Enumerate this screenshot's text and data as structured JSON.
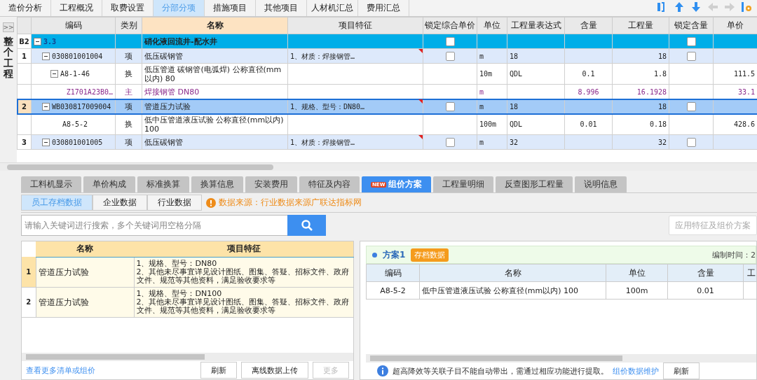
{
  "top_tabs": [
    {
      "label": "造价分析",
      "selected": false
    },
    {
      "label": "工程概况",
      "selected": false
    },
    {
      "label": "取费设置",
      "selected": false
    },
    {
      "label": "分部分项",
      "selected": true
    },
    {
      "label": "措施项目",
      "selected": false
    },
    {
      "label": "其他项目",
      "selected": false
    },
    {
      "label": "人材机汇总",
      "selected": false
    },
    {
      "label": "费用汇总",
      "selected": false
    }
  ],
  "toolbar": [
    {
      "kind": "swap",
      "disabled": false
    },
    {
      "kind": "up",
      "disabled": false
    },
    {
      "kind": "down",
      "disabled": false
    },
    {
      "kind": "left",
      "disabled": true
    },
    {
      "kind": "right",
      "disabled": true
    },
    {
      "kind": "settings",
      "disabled": false
    }
  ],
  "sidebar": {
    "toggle": ">>",
    "title": "整个工程"
  },
  "grid": {
    "columns": [
      "编码",
      "类别",
      "名称",
      "项目特征",
      "锁定综合单价",
      "单位",
      "工程量表达式",
      "含量",
      "工程量",
      "锁定含量",
      "单价"
    ],
    "rows": [
      {
        "kind": "section",
        "num": "B2",
        "code": "3.3",
        "type": "",
        "name": "硝化液回流井-配水井",
        "selected": false,
        "expanded": true,
        "lock_price": false,
        "lock_content": false,
        "children": [
          {
            "kind": "item",
            "num": "1",
            "code": "030801001004",
            "type": "项",
            "name": "低压碳钢管",
            "feature": "1、材质：焊接钢管…",
            "unit": "m",
            "expr": "18",
            "qty": "18",
            "selected": false,
            "expanded": true,
            "lock_price": false,
            "lock_content": false,
            "children": [
              {
                "kind": "sub",
                "code": "A8-1-46",
                "type": "换",
                "name": "低压管道 碳钢管(电弧焊) 公称直径(mm以内) 80",
                "unit": "10m",
                "expr": "QDL",
                "content": "0.1",
                "qty": "1.8",
                "price": "111.5",
                "selected": false,
                "expanded": true,
                "children": [
                  {
                    "kind": "main",
                    "code": "Z1701A23B0…",
                    "type": "主",
                    "name": "焊接钢管 DN80",
                    "unit": "m",
                    "content": "8.996",
                    "qty": "16.1928",
                    "price": "33.1",
                    "selected": false
                  }
                ]
              }
            ]
          },
          {
            "kind": "item",
            "num": "2",
            "code": "WB030817009004",
            "type": "项",
            "name": "管道压力试验",
            "feature": "1、规格、型号：DN80…",
            "unit": "m",
            "expr": "18",
            "qty": "18",
            "selected": true,
            "expanded": true,
            "lock_price": false,
            "lock_content": false,
            "children": [
              {
                "kind": "sub",
                "code": "A8-5-2",
                "type": "换",
                "name": "低中压管道液压试验 公称直径(mm以内) 100",
                "unit": "100m",
                "expr": "QDL",
                "content": "0.01",
                "qty": "0.18",
                "price": "428.6",
                "selected": false
              }
            ]
          },
          {
            "kind": "item",
            "num": "3",
            "code": "030801001005",
            "type": "项",
            "name": "低压碳钢管",
            "feature": "1、材质：焊接钢管…",
            "unit": "m",
            "expr": "32",
            "qty": "32",
            "selected": false,
            "expanded": true,
            "lock_price": false,
            "lock_content": false
          }
        ]
      }
    ]
  },
  "detail_tabs": [
    {
      "label": "工料机显示",
      "selected": false
    },
    {
      "label": "单价构成",
      "selected": false
    },
    {
      "label": "标准换算",
      "selected": false
    },
    {
      "label": "换算信息",
      "selected": false
    },
    {
      "label": "安装费用",
      "selected": false
    },
    {
      "label": "特征及内容",
      "selected": false
    },
    {
      "label": "组价方案",
      "selected": true,
      "badge": "NEW"
    },
    {
      "label": "工程量明细",
      "selected": false
    },
    {
      "label": "反查图形工程量",
      "selected": false
    },
    {
      "label": "说明信息",
      "selected": false
    }
  ],
  "source_tabs": [
    {
      "label": "员工存档数据",
      "selected": true
    },
    {
      "label": "企业数据",
      "selected": false
    },
    {
      "label": "行业数据",
      "selected": false
    }
  ],
  "source_note": "数据来源：行业数据来源广联达指标网",
  "search": {
    "placeholder": "请输入关键词进行搜索，多个关键词用空格分隔"
  },
  "apply_button": {
    "label": "应用特征及组价方案",
    "disabled": true
  },
  "list": {
    "columns": [
      "名称",
      "项目特征"
    ],
    "rows": [
      {
        "num": "1",
        "name": "管道压力试验",
        "feature": "1、规格、型号：DN80\n2、其他未尽事宜详见设计图纸、图集、答疑、招标文件、政府文件、规范等其他资料，满足验收要求等",
        "selected": true
      },
      {
        "num": "2",
        "name": "管道压力试验",
        "feature": "1、规格、型号：DN100\n2、其他未尽事宜详见设计图纸、图集、答疑、招标文件、政府文件、规范等其他资料，满足验收要求等",
        "selected": false
      }
    ]
  },
  "list_footer": {
    "link": "查看更多清单或组价",
    "buttons": [
      {
        "label": "刷新",
        "disabled": false
      },
      {
        "label": "离线数据上传",
        "disabled": false
      },
      {
        "label": "更多",
        "disabled": true
      }
    ]
  },
  "plan": {
    "title": "方案1",
    "badge": "存档数据",
    "time_label": "编制时间：2",
    "columns": [
      "编码",
      "名称",
      "单位",
      "含量",
      "工"
    ],
    "rows": [
      [
        "A8-5-2",
        "低中压管道液压试验 公称直径(mm以内) 100",
        "100m",
        "0.01",
        ""
      ]
    ]
  },
  "plan_footer": {
    "note": "超高降效等关联子目不能自动带出，需通过相应功能进行提取。",
    "link": "组价数据维护",
    "button": "刷新"
  }
}
